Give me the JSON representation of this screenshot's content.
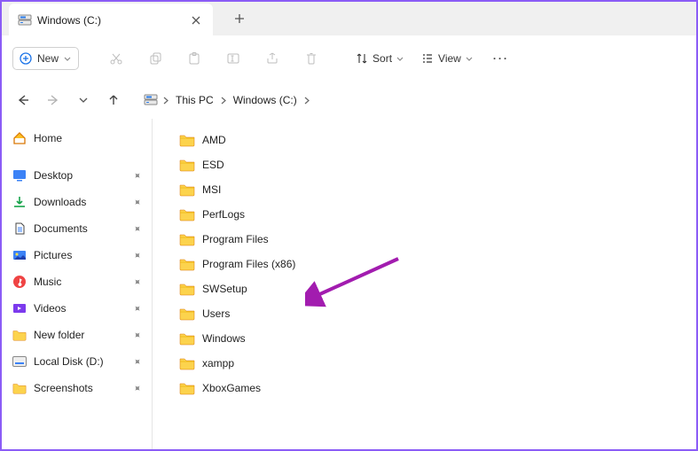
{
  "tab": {
    "title": "Windows (C:)"
  },
  "toolbar": {
    "new_label": "New",
    "sort_label": "Sort",
    "view_label": "View"
  },
  "breadcrumb": {
    "items": [
      "This PC",
      "Windows (C:)"
    ]
  },
  "sidebar": {
    "home_label": "Home",
    "items": [
      {
        "label": "Desktop"
      },
      {
        "label": "Downloads"
      },
      {
        "label": "Documents"
      },
      {
        "label": "Pictures"
      },
      {
        "label": "Music"
      },
      {
        "label": "Videos"
      },
      {
        "label": "New folder"
      },
      {
        "label": "Local Disk (D:)"
      },
      {
        "label": "Screenshots"
      }
    ]
  },
  "folders": [
    {
      "name": "AMD"
    },
    {
      "name": "ESD"
    },
    {
      "name": "MSI"
    },
    {
      "name": "PerfLogs"
    },
    {
      "name": "Program Files"
    },
    {
      "name": "Program Files (x86)"
    },
    {
      "name": "SWSetup"
    },
    {
      "name": "Users"
    },
    {
      "name": "Windows"
    },
    {
      "name": "xampp"
    },
    {
      "name": "XboxGames"
    }
  ]
}
